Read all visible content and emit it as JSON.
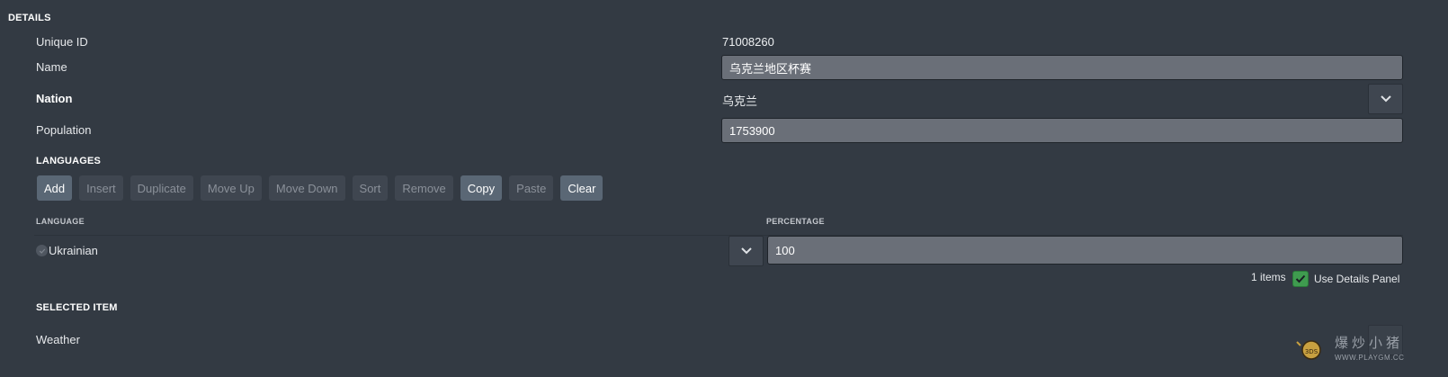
{
  "details": {
    "section_title": "DETAILS",
    "unique_id_label": "Unique ID",
    "unique_id_value": "71008260",
    "name_label": "Name",
    "name_value": "乌克兰地区杯赛",
    "nation_label": "Nation",
    "nation_value": "乌克兰",
    "population_label": "Population",
    "population_value": "1753900"
  },
  "languages": {
    "section_title": "LANGUAGES",
    "buttons": [
      {
        "label": "Add",
        "active": true
      },
      {
        "label": "Insert",
        "active": false
      },
      {
        "label": "Duplicate",
        "active": false
      },
      {
        "label": "Move Up",
        "active": false
      },
      {
        "label": "Move Down",
        "active": false
      },
      {
        "label": "Sort",
        "active": false
      },
      {
        "label": "Remove",
        "active": false
      },
      {
        "label": "Copy",
        "active": true
      },
      {
        "label": "Paste",
        "active": false
      },
      {
        "label": "Clear",
        "active": true
      }
    ],
    "columns": {
      "language": "LANGUAGE",
      "percentage": "PERCENTAGE"
    },
    "rows": [
      {
        "language": "Ukrainian",
        "percentage": "100"
      }
    ],
    "items_count": "1 items",
    "details_panel_label": "Use Details Panel",
    "details_panel_checked": true
  },
  "selected_item": {
    "section_title": "SELECTED ITEM",
    "weather_label": "Weather"
  },
  "watermark": {
    "text": "爆炒小猪",
    "url": "WWW.PLAYGM.CC"
  },
  "colors": {
    "background": "#333a43",
    "field": "#6a6f78",
    "button_active": "#5a6775",
    "button_inactive": "#3f4650",
    "checkbox": "#3f9b4f"
  }
}
